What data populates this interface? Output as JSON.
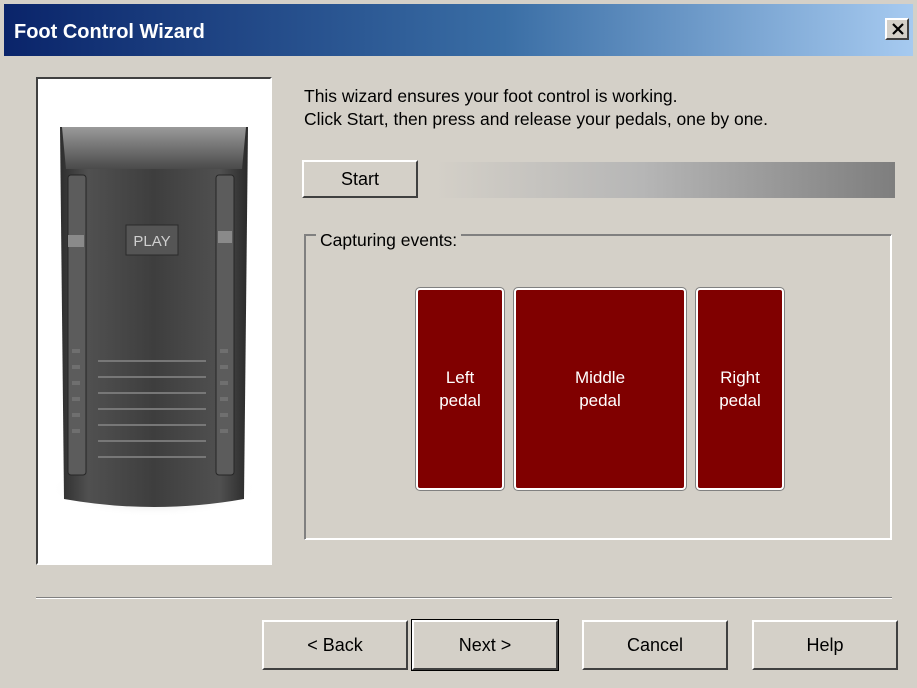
{
  "window": {
    "title": "Foot Control Wizard"
  },
  "device_image": {
    "label": "PLAY"
  },
  "intro": {
    "line1": "This wizard ensures your foot control is working.",
    "line2": "Click Start, then press and release your pedals, one by one."
  },
  "start_button": {
    "label": "Start"
  },
  "progress": {
    "value": 0
  },
  "capture_group": {
    "label": "Capturing events:"
  },
  "pedals": [
    {
      "label": "Left\npedal"
    },
    {
      "label": "Middle\npedal"
    },
    {
      "label": "Right\npedal"
    }
  ],
  "buttons": {
    "back": "< Back",
    "next": "Next >",
    "cancel": "Cancel",
    "help": "Help"
  },
  "colors": {
    "pedal_fill": "#800000",
    "title_gradient_start": "#0a246a",
    "title_gradient_end": "#a6caf0"
  }
}
